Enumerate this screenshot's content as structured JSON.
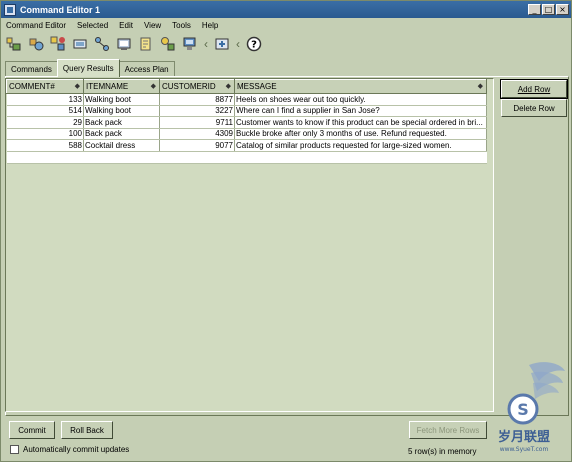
{
  "window": {
    "title": "Command Editor 1"
  },
  "menu": [
    "Command Editor",
    "Selected",
    "Edit",
    "View",
    "Tools",
    "Help"
  ],
  "toolbar_icons": [
    "execute-icon",
    "explain-icon",
    "results-icon",
    "options-icon",
    "connect-icon",
    "plan-icon",
    "history-icon",
    "wizard-icon",
    "network-icon",
    "assist-icon",
    "help-icon"
  ],
  "tabs": [
    {
      "label": "Commands",
      "active": false
    },
    {
      "label": "Query Results",
      "active": true
    },
    {
      "label": "Access Plan",
      "active": false
    }
  ],
  "grid": {
    "columns": [
      "COMMENT#",
      "ITEMNAME",
      "CUSTOMERID",
      "MESSAGE"
    ],
    "rows": [
      [
        "133",
        "Walking boot",
        "8877",
        "Heels on shoes wear out too quickly."
      ],
      [
        "514",
        "Walking boot",
        "3227",
        "Where can I find a supplier in San Jose?"
      ],
      [
        "29",
        "Back pack",
        "9711",
        "Customer wants to know if this product can be special ordered in bri..."
      ],
      [
        "100",
        "Back pack",
        "4309",
        "Buckle broke after only 3 months of use.  Refund requested."
      ],
      [
        "588",
        "Cocktail dress",
        "9077",
        "Catalog of similar products requested for large-sized women."
      ]
    ]
  },
  "buttons": {
    "add_row": "Add Row",
    "delete_row": "Delete Row",
    "commit": "Commit",
    "roll_back": "Roll Back",
    "fetch_more": "Fetch More Rows"
  },
  "auto_commit_label": "Automatically commit updates",
  "auto_commit_checked": false,
  "status": "5 row(s) in memory",
  "watermark": {
    "text": "岁月联盟",
    "sub": "www.SyueT.com"
  }
}
